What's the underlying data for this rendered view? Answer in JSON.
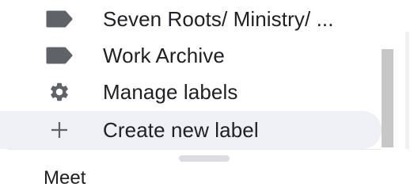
{
  "labels": {
    "items": [
      {
        "label": "Seven Roots/ Ministry/ ...",
        "icon": "label-icon"
      },
      {
        "label": "Work Archive",
        "icon": "label-icon"
      }
    ]
  },
  "actions": {
    "manage_labels": "Manage labels",
    "create_new_label": "Create new label"
  },
  "meet": {
    "title": "Meet"
  },
  "colors": {
    "icon": "#5f6368",
    "text": "#202124",
    "hover_bg": "#eef0f3",
    "scrollbar": "#c7c7c7"
  }
}
